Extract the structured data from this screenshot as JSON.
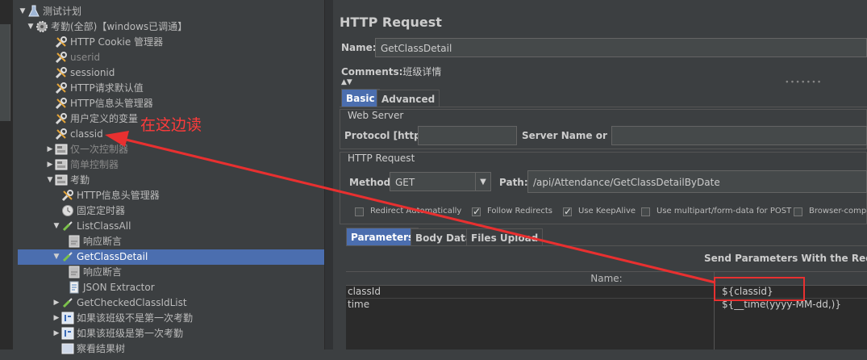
{
  "tree": {
    "items": [
      {
        "label": "测试计划",
        "level": 0,
        "toggle": "▼",
        "icon": "flask-icon"
      },
      {
        "label": "考勤(全部)【windows已调通】",
        "level": 1,
        "toggle": "▼",
        "icon": "gear-icon"
      },
      {
        "label": "HTTP Cookie 管理器",
        "level": 2,
        "toggle": "",
        "icon": "wrench-icon"
      },
      {
        "label": "userid",
        "level": 2,
        "toggle": "",
        "icon": "wrench-icon",
        "dim": true
      },
      {
        "label": "sessionid",
        "level": 2,
        "toggle": "",
        "icon": "wrench-icon"
      },
      {
        "label": "HTTP请求默认值",
        "level": 2,
        "toggle": "",
        "icon": "wrench-icon"
      },
      {
        "label": "HTTP信息头管理器",
        "level": 2,
        "toggle": "",
        "icon": "wrench-icon"
      },
      {
        "label": "用户定义的变量",
        "level": 2,
        "toggle": "",
        "icon": "wrench-icon"
      },
      {
        "label": "classid",
        "level": 2,
        "toggle": "",
        "icon": "wrench-icon"
      },
      {
        "label": "仅一次控制器",
        "level": 2,
        "toggle": "▶",
        "icon": "controller-icon",
        "dim": true
      },
      {
        "label": "简单控制器",
        "level": 2,
        "toggle": "▶",
        "icon": "controller-icon",
        "dim": true
      },
      {
        "label": "考勤",
        "level": 2,
        "toggle": "▼",
        "icon": "controller-icon"
      },
      {
        "label": "HTTP信息头管理器",
        "level": 3,
        "toggle": "",
        "icon": "wrench-icon"
      },
      {
        "label": "固定定时器",
        "level": 3,
        "toggle": "",
        "icon": "timer-icon"
      },
      {
        "label": "ListClassAll",
        "level": 3,
        "toggle": "▼",
        "icon": "pipette-icon"
      },
      {
        "label": "响应断言",
        "level": 4,
        "toggle": "",
        "icon": "assertion-icon"
      },
      {
        "label": "GetClassDetail",
        "level": 3,
        "toggle": "▼",
        "icon": "pipette-icon",
        "selected": true
      },
      {
        "label": "响应断言",
        "level": 4,
        "toggle": "",
        "icon": "assertion-icon"
      },
      {
        "label": "JSON Extractor",
        "level": 4,
        "toggle": "",
        "icon": "document-icon"
      },
      {
        "label": "GetCheckedClassIdList",
        "level": 3,
        "toggle": "▶",
        "icon": "pipette-icon"
      },
      {
        "label": "如果该班级不是第一次考勤",
        "level": 3,
        "toggle": "▶",
        "icon": "if-controller-icon"
      },
      {
        "label": "如果该班级是第一次考勤",
        "level": 3,
        "toggle": "▶",
        "icon": "if-controller-icon"
      },
      {
        "label": "察看结果树",
        "level": 3,
        "toggle": "",
        "icon": "listener-icon"
      }
    ]
  },
  "annotation": {
    "text": "在这边读",
    "color": "#ff3b3b"
  },
  "panel": {
    "title": "HTTP Request",
    "name_label": "Name:",
    "name_value": "GetClassDetail",
    "comments_label": "Comments:",
    "comments_value": "班级详情",
    "tabs": [
      {
        "label": "Basic",
        "active": true
      },
      {
        "label": "Advanced",
        "active": false
      }
    ],
    "web_server": {
      "title": "Web Server",
      "protocol_label": "Protocol [http]:",
      "protocol_value": "",
      "server_label": "Server Name or IP:",
      "server_value": ""
    },
    "http_request": {
      "title": "HTTP Request",
      "method_label": "Method:",
      "method_value": "GET",
      "path_label": "Path:",
      "path_value": "/api/Attendance/GetClassDetailByDate"
    },
    "options": [
      {
        "label": "Redirect Automatically",
        "checked": false
      },
      {
        "label": "Follow Redirects",
        "checked": true
      },
      {
        "label": "Use KeepAlive",
        "checked": true
      },
      {
        "label": "Use multipart/form-data for POST",
        "checked": false
      },
      {
        "label": "Browser-compa",
        "checked": false
      }
    ],
    "sub_tabs": [
      {
        "label": "Parameters",
        "active": true
      },
      {
        "label": "Body Data",
        "active": false
      },
      {
        "label": "Files Upload",
        "active": false
      }
    ],
    "send_params_label": "Send Parameters With the Request:",
    "table": {
      "header_name": "Name:",
      "rows": [
        {
          "name": "classId",
          "value": "${classid}"
        },
        {
          "name": "time",
          "value": "${__time(yyyy-MM-dd,)}"
        }
      ]
    }
  }
}
